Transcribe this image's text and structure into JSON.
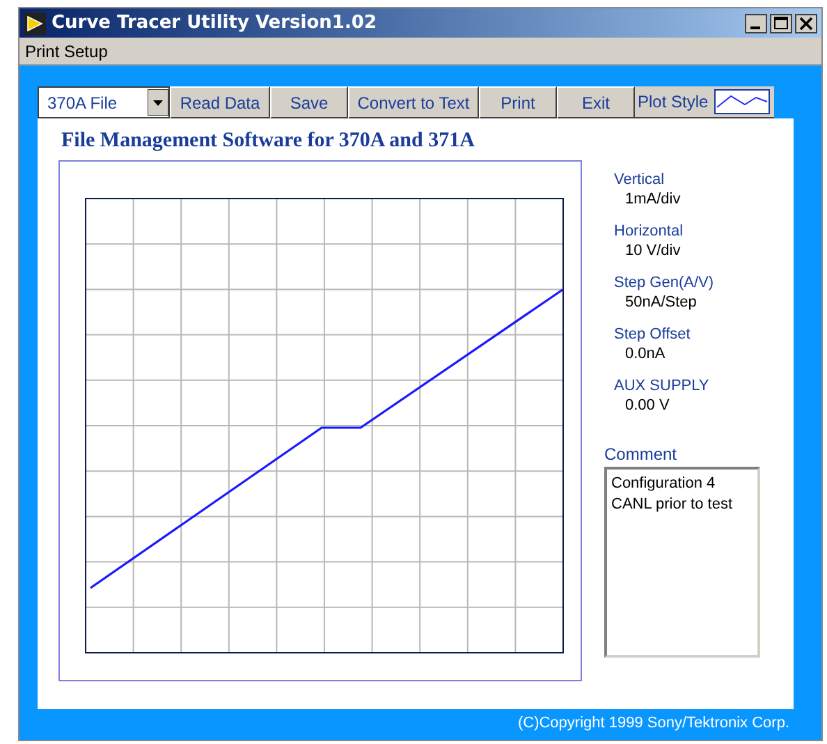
{
  "window": {
    "title": "Curve Tracer Utility Version1.02"
  },
  "menu": [
    "Print Setup"
  ],
  "toolbar": {
    "file_selector": "370A File",
    "buttons": [
      "Read Data",
      "Save",
      "Convert to Text",
      "Print",
      "Exit"
    ],
    "plot_style_label": "Plot Style"
  },
  "heading": "File Management Software for 370A and 371A",
  "readouts": [
    {
      "label": "Vertical",
      "value": "1mA/div"
    },
    {
      "label": "Horizontal",
      "value": "10 V/div"
    },
    {
      "label": "Step Gen(A/V)",
      "value": "50nA/Step"
    },
    {
      "label": "Step Offset",
      "value": "0.0nA"
    },
    {
      "label": "AUX SUPPLY",
      "value": "0.00 V"
    }
  ],
  "comment": {
    "label": "Comment",
    "value": "Configuration 4\nCANL prior to test"
  },
  "footer": "(C)Copyright 1999 Sony/Tektronix Corp."
}
